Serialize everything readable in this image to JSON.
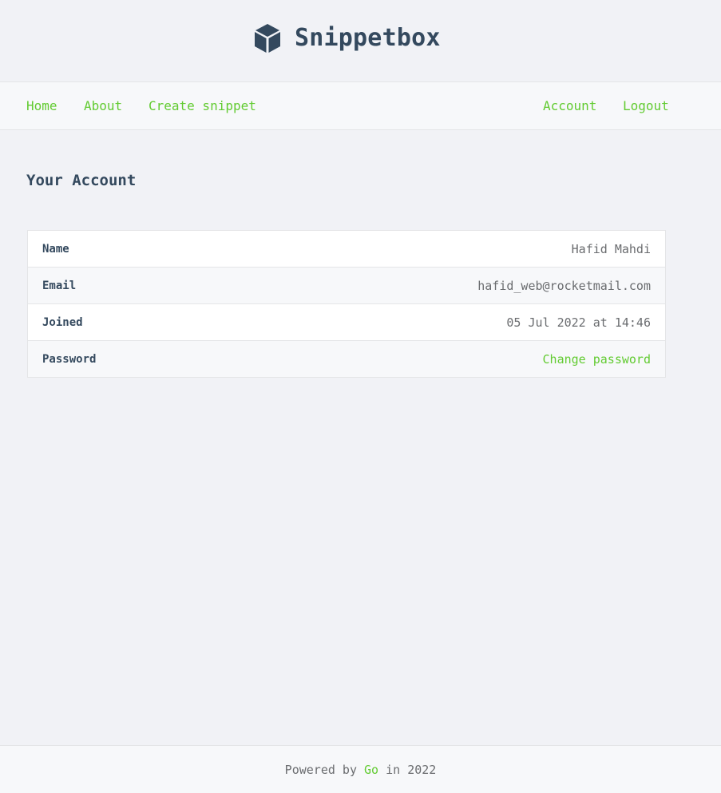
{
  "header": {
    "brand_name": "Snippetbox",
    "brand_icon": "cube-icon"
  },
  "nav": {
    "home": "Home",
    "about": "About",
    "create": "Create snippet",
    "account": "Account",
    "logout": "Logout"
  },
  "main": {
    "title": "Your Account",
    "rows": [
      {
        "label": "Name",
        "value": "Hafid Mahdi"
      },
      {
        "label": "Email",
        "value": "hafid_web@rocketmail.com"
      },
      {
        "label": "Joined",
        "value": "05 Jul 2022 at 14:46"
      },
      {
        "label": "Password",
        "value": "Change password"
      }
    ]
  },
  "footer": {
    "prefix": "Powered by",
    "link": "Go",
    "suffix": "in 2022"
  },
  "colors": {
    "accent": "#62cb31",
    "text": "#34495e",
    "muted": "#6a6c6f",
    "background": "#f1f2f6",
    "panel": "#f7f8fa"
  }
}
